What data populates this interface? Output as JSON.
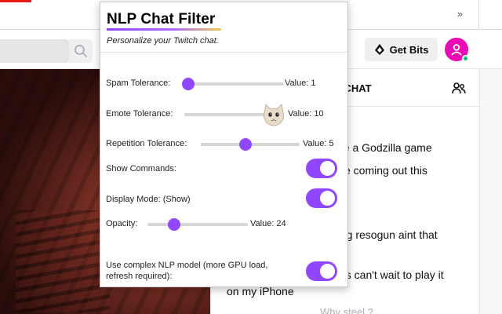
{
  "header": {
    "overflow_glyph": "»",
    "get_bits_label": "Get Bits"
  },
  "chat": {
    "title": "M CHAT",
    "lines": [
      "ne a Godzilla game",
      "ite coming out this",
      "ding resogun aint that",
      "es can't wait to play it",
      "on my iPhone"
    ],
    "input_hint": "Why steel ?"
  },
  "popup": {
    "title": "NLP Chat Filter",
    "subtitle": "Personalize your Twitch chat.",
    "settings": {
      "spam": {
        "label": "Spam Tolerance:",
        "value_text": "Value: 1",
        "value": 1
      },
      "emote": {
        "label": "Emote Tolerance:",
        "value_text": "Value: 10",
        "value": 10,
        "thumb_icon": "cat-emote-icon"
      },
      "repetition": {
        "label": "Repetition Tolerance:",
        "value_text": "Value: 5",
        "value": 5
      },
      "show_commands": {
        "label": "Show Commands:",
        "on": true
      },
      "display_mode": {
        "label": "Display Mode: (Show)",
        "on": true
      },
      "opacity": {
        "label": "Opacity:",
        "value_text": "Value: 24",
        "value": 24
      },
      "complex_model": {
        "label_line1": "Use complex NLP model (more GPU load,",
        "label_line2": "refresh required):",
        "on": true
      }
    }
  },
  "colors": {
    "accent": "#9146ff",
    "avatar": "#e90cb5",
    "online": "#00c56e"
  }
}
